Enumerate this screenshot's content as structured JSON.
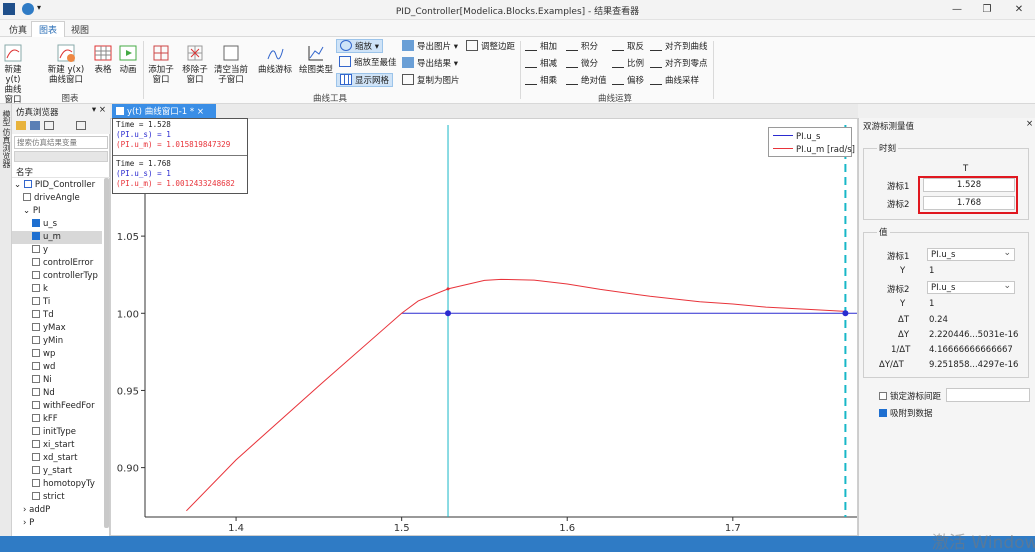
{
  "window": {
    "title": "PID_Controller[Modelica.Blocks.Examples] - 结果查看器",
    "minimize": "—",
    "restore": "❐",
    "close": "✕"
  },
  "menu": {
    "tabs": [
      {
        "label": "仿真",
        "active": false
      },
      {
        "label": "图表",
        "active": true
      },
      {
        "label": "视图",
        "active": false
      }
    ]
  },
  "ribbon": {
    "chart_group": {
      "label": "图表",
      "new_yt": "新建 y(t) 曲线窗口",
      "new_yx": "新建 y(x) 曲线窗口",
      "table": "表格",
      "animation": "动画"
    },
    "curve_tools": {
      "label": "曲线工具",
      "add_subwindow": "添加子窗口",
      "remove_subwindow": "移除子窗口",
      "clear_subwindow": "清空当前子窗口",
      "cursor": "曲线游标",
      "plot_type": "绘图类型",
      "zoom": "缩放",
      "zoom_best": "缩放至最佳",
      "show_grid": "显示网格",
      "export_image": "导出图片",
      "export_result": "导出结果",
      "copy_image": "复制为图片",
      "adjust_margin": "调整边距"
    },
    "curve_ops": {
      "label": "曲线运算",
      "add": "相加",
      "integral": "积分",
      "invert": "取反",
      "align_curve": "对齐到曲线",
      "subtract": "相减",
      "differential": "微分",
      "scale": "比例",
      "align_zero": "对齐到零点",
      "multiply": "相乘",
      "absolute": "绝对值",
      "offset": "偏移",
      "sample": "曲线采样"
    }
  },
  "side_strip": {
    "label1": "模型",
    "label2": "仿真浏览器"
  },
  "browser": {
    "title": "仿真浏览器",
    "search_placeholder": "搜索仿真结果变量",
    "column": "名字",
    "tree": [
      {
        "label": "PID_Controller",
        "indent": 0,
        "type": "root",
        "expanded": true
      },
      {
        "label": "driveAngle",
        "indent": 1,
        "type": "check",
        "checked": false
      },
      {
        "label": "PI",
        "indent": 1,
        "type": "node",
        "expanded": true
      },
      {
        "label": "u_s",
        "indent": 2,
        "type": "check",
        "checked": true
      },
      {
        "label": "u_m",
        "indent": 2,
        "type": "check",
        "checked": true,
        "selected": true
      },
      {
        "label": "y",
        "indent": 2,
        "type": "check",
        "checked": false
      },
      {
        "label": "controlError",
        "indent": 2,
        "type": "check",
        "checked": false
      },
      {
        "label": "controllerTyp",
        "indent": 2,
        "type": "check",
        "checked": false
      },
      {
        "label": "k",
        "indent": 2,
        "type": "check",
        "checked": false
      },
      {
        "label": "Ti",
        "indent": 2,
        "type": "check",
        "checked": false
      },
      {
        "label": "Td",
        "indent": 2,
        "type": "check",
        "checked": false
      },
      {
        "label": "yMax",
        "indent": 2,
        "type": "check",
        "checked": false
      },
      {
        "label": "yMin",
        "indent": 2,
        "type": "check",
        "checked": false
      },
      {
        "label": "wp",
        "indent": 2,
        "type": "check",
        "checked": false
      },
      {
        "label": "wd",
        "indent": 2,
        "type": "check",
        "checked": false
      },
      {
        "label": "Ni",
        "indent": 2,
        "type": "check",
        "checked": false
      },
      {
        "label": "Nd",
        "indent": 2,
        "type": "check",
        "checked": false
      },
      {
        "label": "withFeedFor",
        "indent": 2,
        "type": "check",
        "checked": false
      },
      {
        "label": "kFF",
        "indent": 2,
        "type": "check",
        "checked": false
      },
      {
        "label": "initType",
        "indent": 2,
        "type": "check",
        "checked": false
      },
      {
        "label": "xi_start",
        "indent": 2,
        "type": "check",
        "checked": false
      },
      {
        "label": "xd_start",
        "indent": 2,
        "type": "check",
        "checked": false
      },
      {
        "label": "y_start",
        "indent": 2,
        "type": "check",
        "checked": false
      },
      {
        "label": "homotopyTy",
        "indent": 2,
        "type": "check",
        "checked": false
      },
      {
        "label": "strict",
        "indent": 2,
        "type": "check",
        "checked": false
      },
      {
        "label": "addP",
        "indent": 1,
        "type": "node",
        "expanded": false
      },
      {
        "label": "P",
        "indent": 1,
        "type": "node",
        "expanded": false
      }
    ]
  },
  "plot_tab": {
    "label": "y(t) 曲线窗口-1 *",
    "close": "×"
  },
  "readout": {
    "c1_time": "Time = 1.528",
    "c1_us": "(PI.u_s) = 1",
    "c1_um": "(PI.u_m) = 1.015819847329",
    "c2_time": "Time = 1.768",
    "c2_us": "(PI.u_s) = 1",
    "c2_um": "(PI.u_m) = 1.0012433248682"
  },
  "chart_data": {
    "type": "line",
    "xlim": [
      1.345,
      1.775
    ],
    "ylim": [
      0.868,
      1.122
    ],
    "x_ticks": [
      "1.4",
      "1.5",
      "1.6",
      "1.7"
    ],
    "x_tick_values": [
      1.4,
      1.5,
      1.6,
      1.7
    ],
    "y_ticks": [
      "0.90",
      "0.95",
      "1.00",
      "1.05"
    ],
    "y_tick_values": [
      0.9,
      0.95,
      1.0,
      1.05
    ],
    "grid": false,
    "legend_position": "top-right",
    "series": [
      {
        "name": "PI.u_s",
        "color": "#2b2bd0",
        "x": [
          1.5,
          1.775
        ],
        "y": [
          1.0,
          1.0
        ]
      },
      {
        "name": "PI.u_m [rad/s]",
        "color": "#e8333a",
        "x": [
          1.37,
          1.4,
          1.45,
          1.5,
          1.51,
          1.528,
          1.55,
          1.56,
          1.58,
          1.6,
          1.62,
          1.65,
          1.68,
          1.7,
          1.72,
          1.75,
          1.768
        ],
        "y": [
          0.872,
          0.905,
          0.953,
          1.0,
          1.008,
          1.0158,
          1.0213,
          1.022,
          1.0215,
          1.019,
          1.0155,
          1.011,
          1.0075,
          1.006,
          1.004,
          1.0023,
          1.0012
        ]
      }
    ],
    "cursors": [
      {
        "x": 1.528,
        "color": "#18b7c7",
        "style": "solid"
      },
      {
        "x": 1.768,
        "color": "#18b7c7",
        "style": "dashed"
      }
    ]
  },
  "dual_cursor": {
    "title": "双游标测量值",
    "close": "×",
    "time_section": "时刻",
    "col_header": "T",
    "cursor1_label": "游标1",
    "cursor1_value": "1.528",
    "cursor2_label": "游标2",
    "cursor2_value": "1.768",
    "value_section": "值",
    "v_cursor1_label": "游标1",
    "v_cursor1_var": "PI.u_s",
    "y1_label": "Y",
    "y1_value": "1",
    "v_cursor2_label": "游标2",
    "v_cursor2_var": "PI.u_s",
    "y2_label": "Y",
    "y2_value": "1",
    "dt_label": "ΔT",
    "dt_value": "0.24",
    "dy_label": "ΔY",
    "dy_value": "2.220446...5031e-16",
    "inv_dt_label": "1/ΔT",
    "inv_dt_value": "4.16666666666667",
    "dydt_label": "ΔY/ΔT",
    "dydt_value": "9.251858...4297e-16",
    "lock_label": "锁定游标间距",
    "lock_checked": false,
    "snap_label": "吸附到数据",
    "snap_checked": true
  },
  "watermark": "激活 Windows",
  "colors": {
    "accent": "#2f7bc5",
    "tab_active": "#3a8ee6",
    "highlight_box": "#e0171f"
  }
}
